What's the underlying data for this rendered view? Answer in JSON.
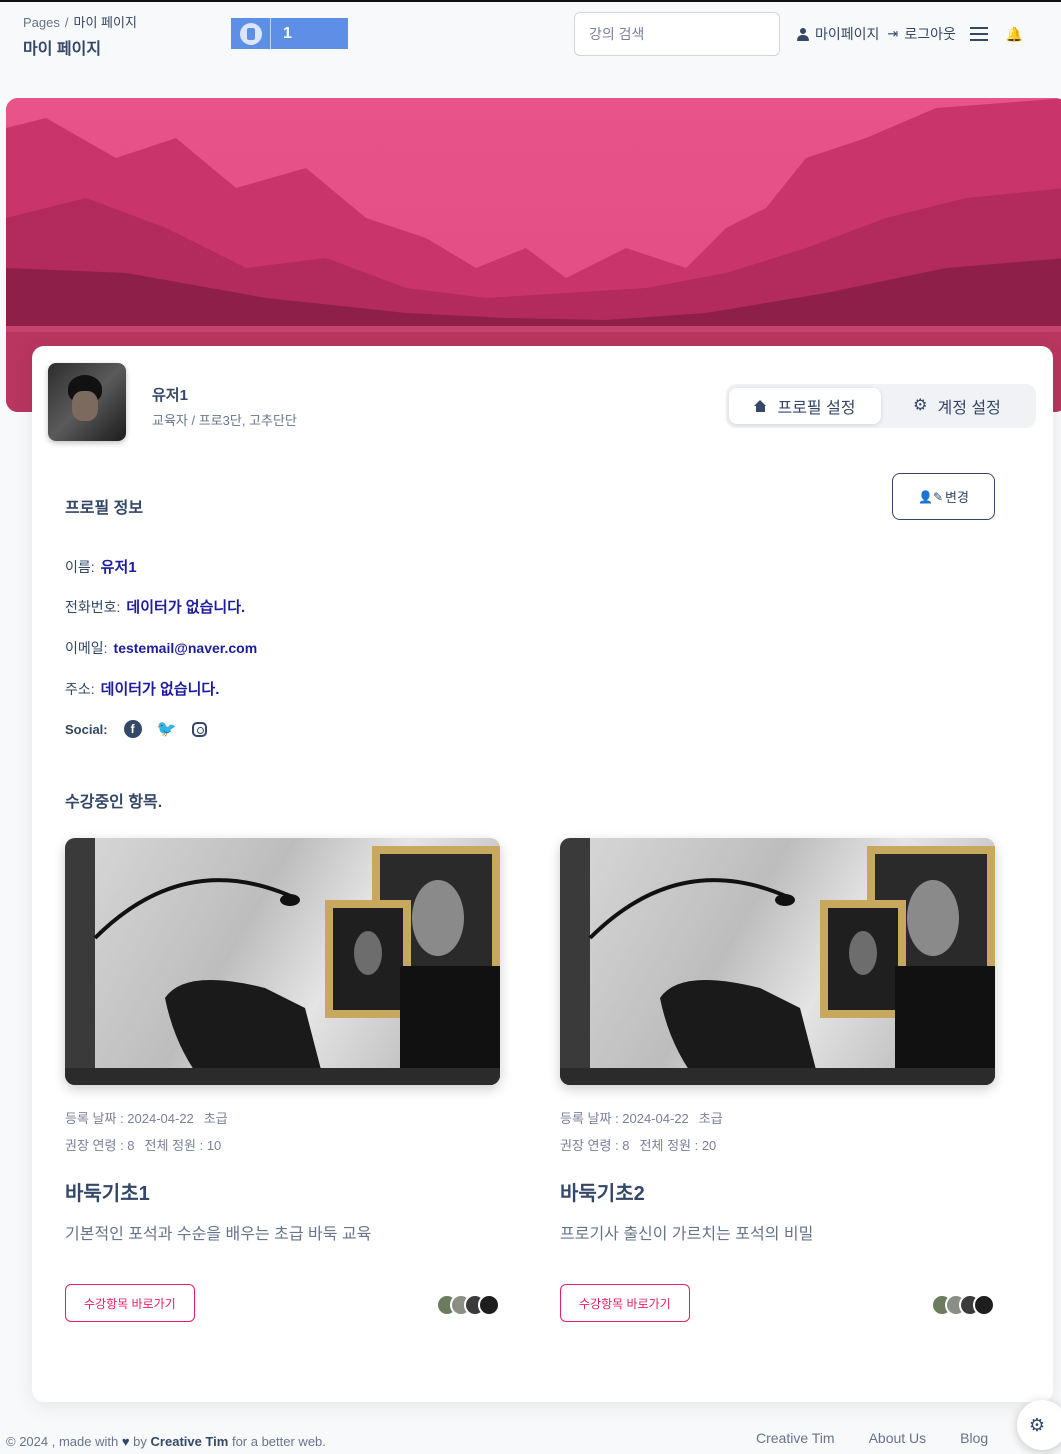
{
  "navbar": {
    "breadcrumb_root": "Pages",
    "breadcrumb_sep": "/",
    "breadcrumb_current": "마이 페이지",
    "page_title": "마이 페이지",
    "rank_number": "1",
    "search_placeholder": "강의 검색",
    "mypage_label": "마이페이지",
    "logout_label": "로그아웃"
  },
  "profile": {
    "name": "유저1",
    "role": "교육자 / 프로3단, 고추단단",
    "tabs": [
      {
        "label": "프로필 설정",
        "icon": "home-icon",
        "active": true
      },
      {
        "label": "계정 설정",
        "icon": "gear-icon",
        "active": false
      }
    ]
  },
  "info": {
    "section_title": "프로필 정보",
    "edit_label": "변경",
    "name_label": "이름:",
    "name_value": "유저1",
    "phone_label": "전화번호:",
    "phone_value": "데이터가 없습니다.",
    "email_label": "이메일:",
    "email_value": "testemail@naver.com",
    "address_label": "주소:",
    "address_value": "데이터가 없습니다.",
    "social_label": "Social:"
  },
  "courses_section": {
    "title": "수강중인 항목.",
    "items": [
      {
        "reg_date": "등록 날짜 : 2024-04-22",
        "level": "초급",
        "age": "권장 연령 : 8",
        "capacity": "전체 정원 : 10",
        "title": "바둑기초1",
        "description": "기본적인 포석과 수순을 배우는 초급 바둑 교육",
        "button_label": "수강항목 바로가기"
      },
      {
        "reg_date": "등록 날짜 : 2024-04-22",
        "level": "초급",
        "age": "권장 연령 : 8",
        "capacity": "전체 정원 : 20",
        "title": "바둑기초2",
        "description": "프로기사 출신이 가르치는 포석의 비밀",
        "button_label": "수강항목 바로가기"
      }
    ]
  },
  "footer": {
    "prefix": "© 2024 , made with",
    "by": "by",
    "brand": "Creative Tim",
    "suffix": "for a better web.",
    "links": [
      "Creative Tim",
      "About Us",
      "Blog"
    ]
  },
  "colors": {
    "primary": "#e91e63",
    "text": "#344767",
    "value": "#1c1c9e",
    "rank_badge": "#5e8fe6"
  }
}
